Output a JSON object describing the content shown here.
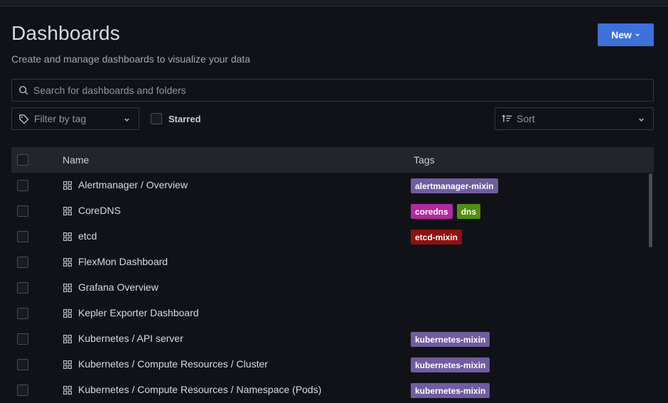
{
  "page": {
    "title": "Dashboards",
    "subtitle": "Create and manage dashboards to visualize your data"
  },
  "toolbar": {
    "new_label": "New"
  },
  "search": {
    "placeholder": "Search for dashboards and folders"
  },
  "filters": {
    "tag_placeholder": "Filter by tag",
    "starred_label": "Starred",
    "sort_placeholder": "Sort"
  },
  "table": {
    "columns": {
      "name": "Name",
      "tags": "Tags"
    },
    "rows": [
      {
        "name": "Alertmanager / Overview",
        "tags": [
          {
            "label": "alertmanager-mixin",
            "color": "#705da0"
          }
        ]
      },
      {
        "name": "CoreDNS",
        "tags": [
          {
            "label": "coredns",
            "color": "#b22a9e"
          },
          {
            "label": "dns",
            "color": "#508f0f"
          }
        ]
      },
      {
        "name": "etcd",
        "tags": [
          {
            "label": "etcd-mixin",
            "color": "#8f1010"
          }
        ]
      },
      {
        "name": "FlexMon Dashboard",
        "tags": []
      },
      {
        "name": "Grafana Overview",
        "tags": []
      },
      {
        "name": "Kepler Exporter Dashboard",
        "tags": []
      },
      {
        "name": "Kubernetes / API server",
        "tags": [
          {
            "label": "kubernetes-mixin",
            "color": "#705da0"
          }
        ]
      },
      {
        "name": "Kubernetes / Compute Resources / Cluster",
        "tags": [
          {
            "label": "kubernetes-mixin",
            "color": "#705da0"
          }
        ]
      },
      {
        "name": "Kubernetes / Compute Resources / Namespace (Pods)",
        "tags": [
          {
            "label": "kubernetes-mixin",
            "color": "#705da0"
          }
        ]
      }
    ]
  },
  "colors": {
    "background": "#111217",
    "primary": "#3d71d9",
    "text": "#ccccdc"
  },
  "icons": {
    "search": "search-icon",
    "tag": "tag-icon",
    "sort": "sort-icon",
    "dashboard": "dashboard-grid-icon",
    "chevron": "chevron-down-icon"
  }
}
